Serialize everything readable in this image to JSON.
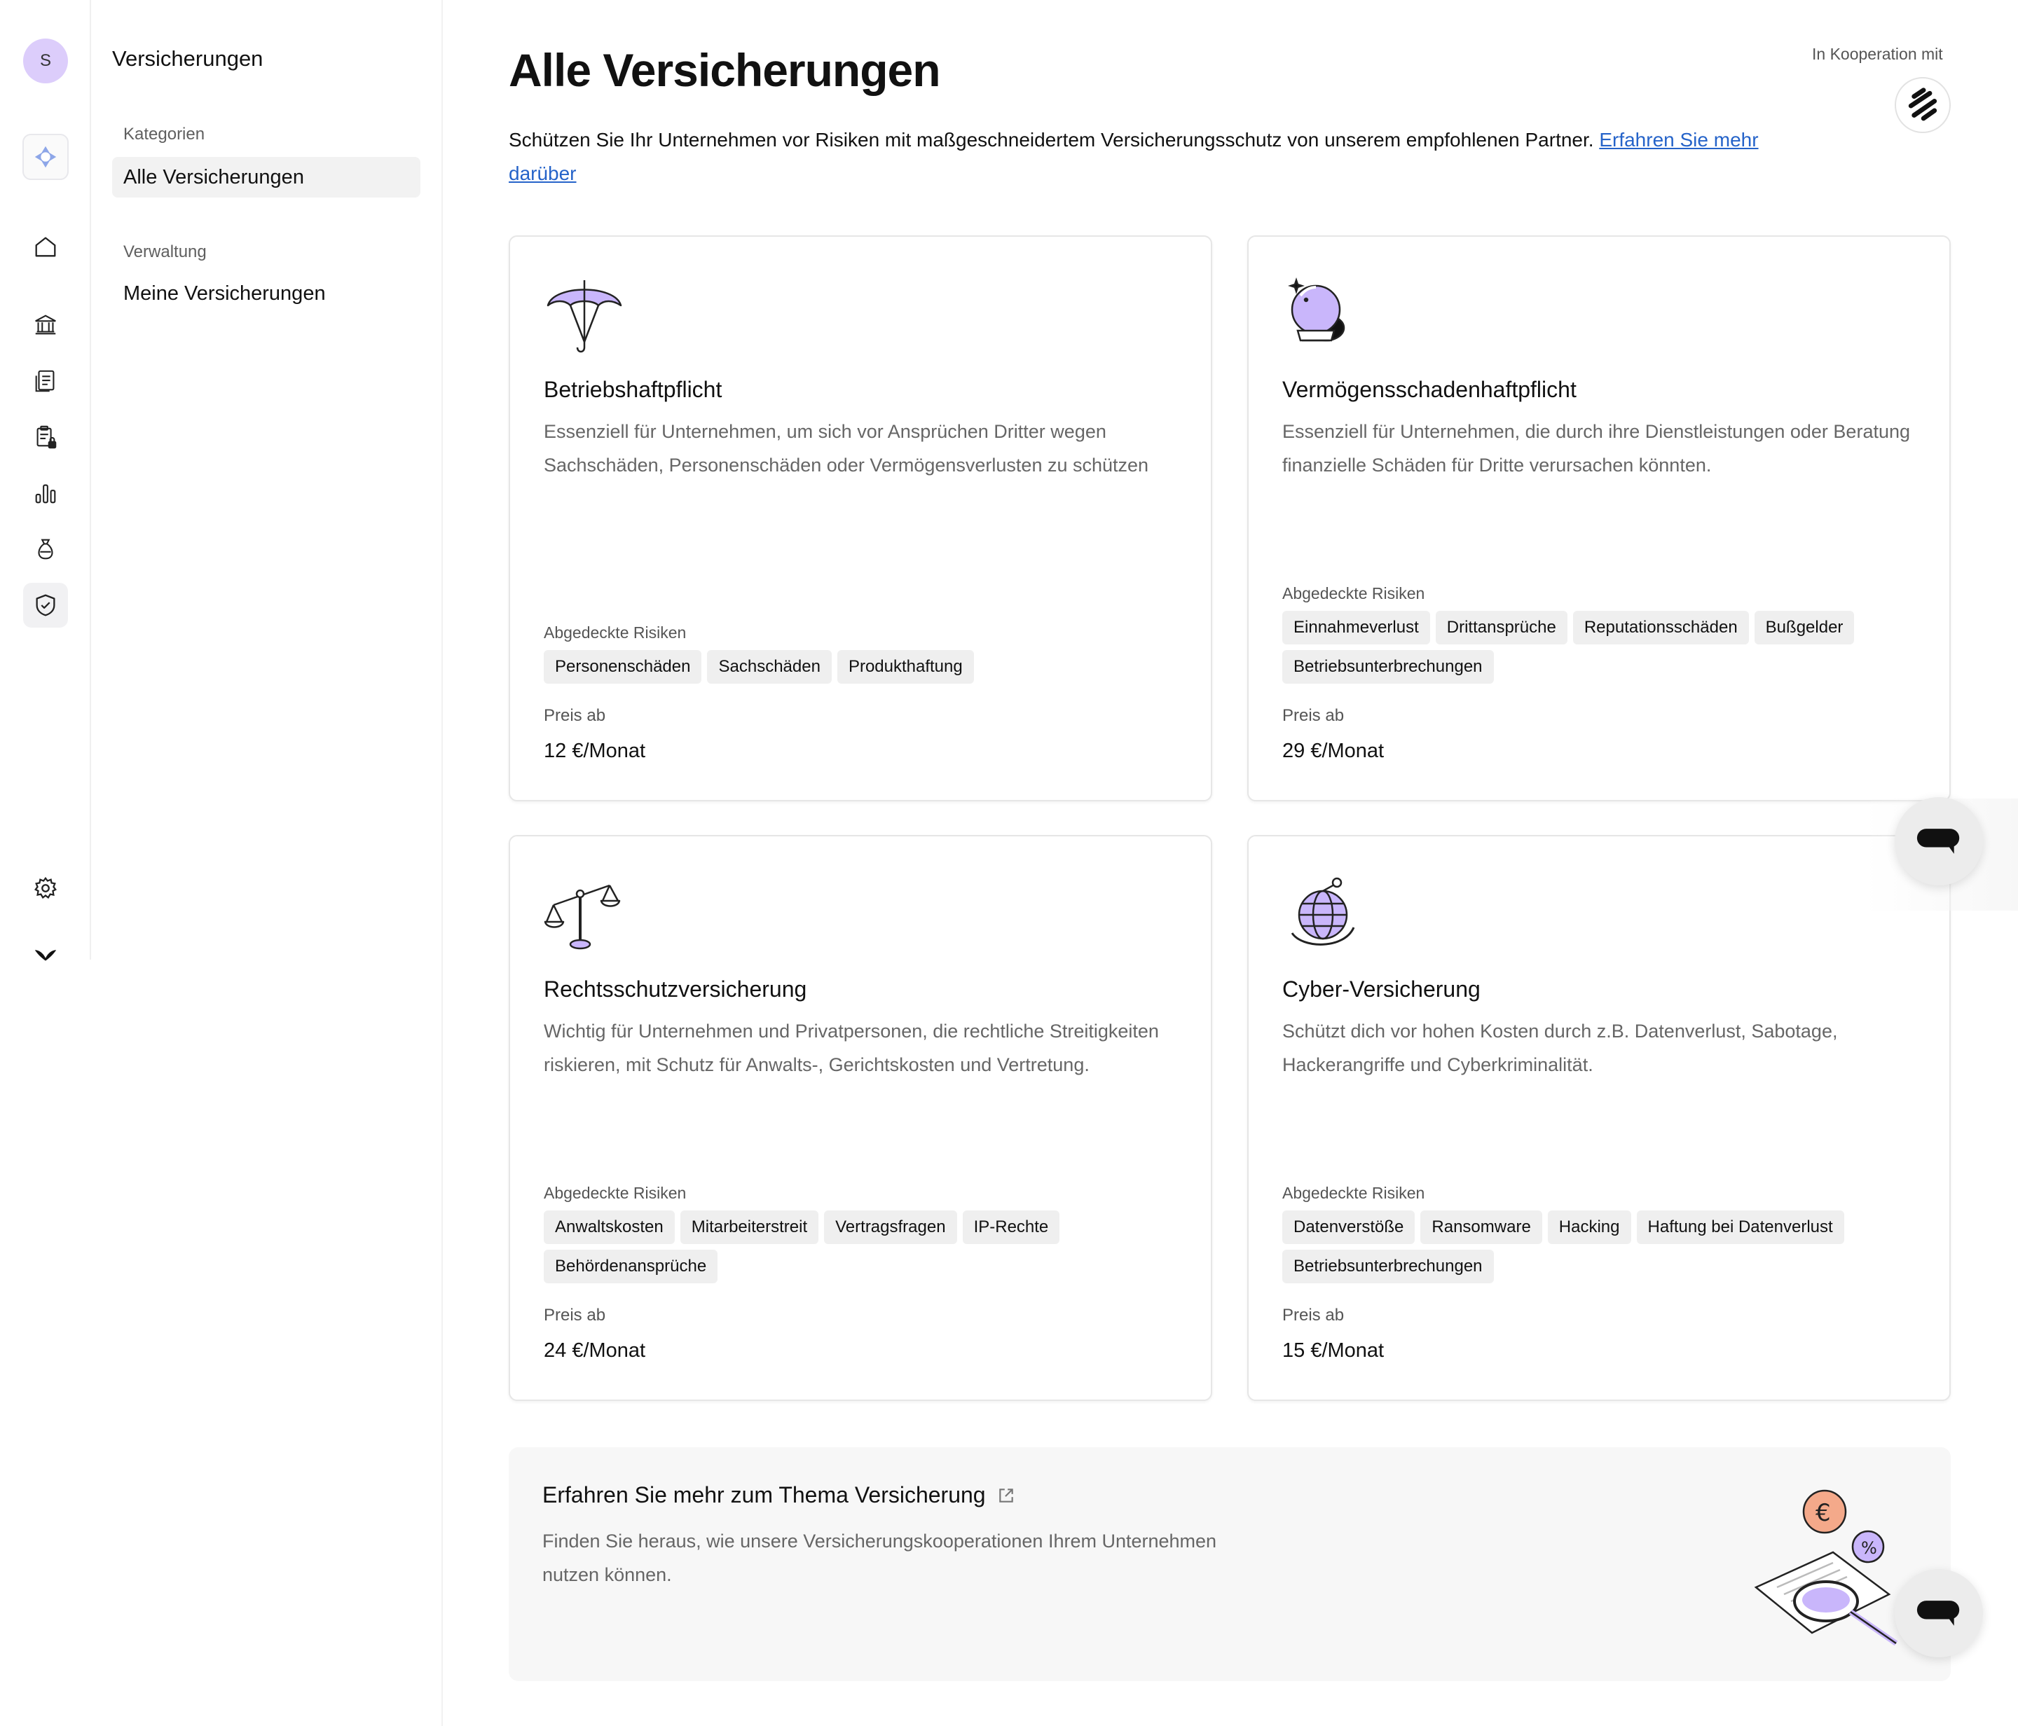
{
  "rail": {
    "avatar_initial": "S",
    "icons": [
      "app-logo-icon",
      "home-icon",
      "bank-icon",
      "document-list-icon",
      "clipboard-lock-icon",
      "bar-chart-icon",
      "money-bag-icon",
      "shield-check-icon",
      "gear-icon",
      "brand-bird-icon"
    ]
  },
  "subnav": {
    "title": "Versicherungen",
    "sections": [
      {
        "label": "Kategorien",
        "items": [
          {
            "label": "Alle Versicherungen",
            "active": true
          }
        ]
      },
      {
        "label": "Verwaltung",
        "items": [
          {
            "label": "Meine Versicherungen",
            "active": false
          }
        ]
      }
    ]
  },
  "header": {
    "title": "Alle Versicherungen",
    "coop_label": "In Kooperation mit",
    "intro_text": "Schützen Sie Ihr Unternehmen vor Risiken mit maßgeschneidertem Versicherungsschutz von unserem empfohlenen Partner. ",
    "intro_link": "Erfahren Sie mehr darüber"
  },
  "cards": [
    {
      "icon": "umbrella-icon",
      "title": "Betriebshaftpflicht",
      "description": "Essenziell für Unternehmen, um sich vor Ansprüchen Dritter wegen Sachschäden, Personenschäden oder Vermögensverlusten zu schützen",
      "risks_label": "Abgedeckte Risiken",
      "risks": [
        "Personenschäden",
        "Sachschäden",
        "Produkthaftung"
      ],
      "price_label": "Preis ab",
      "price": "12 €/Monat"
    },
    {
      "icon": "crystal-ball-icon",
      "title": "Vermögensschadenhaftpflicht",
      "description": "Essenziell für Unternehmen, die durch ihre Dienstleistungen oder Beratung finanzielle Schäden für Dritte verursachen könnten.",
      "risks_label": "Abgedeckte Risiken",
      "risks": [
        "Einnahmeverlust",
        "Drittansprüche",
        "Reputationsschäden",
        "Bußgelder",
        "Betriebsunterbrechungen"
      ],
      "price_label": "Preis ab",
      "price": "29 €/Monat"
    },
    {
      "icon": "scales-icon",
      "title": "Rechtsschutzversicherung",
      "description": "Wichtig für Unternehmen und Privatpersonen, die rechtliche Streitigkeiten riskieren, mit Schutz für Anwalts-, Gerichtskosten und Vertretung.",
      "risks_label": "Abgedeckte Risiken",
      "risks": [
        "Anwaltskosten",
        "Mitarbeiterstreit",
        "Vertragsfragen",
        "IP-Rechte",
        "Behördenansprüche"
      ],
      "price_label": "Preis ab",
      "price": "24 €/Monat"
    },
    {
      "icon": "globe-icon",
      "title": "Cyber-Versicherung",
      "description": "Schützt dich vor hohen Kosten durch z.B. Datenverlust, Sabotage, Hackerangriffe und Cyberkriminalität.",
      "risks_label": "Abgedeckte Risiken",
      "risks": [
        "Datenverstöße",
        "Ransomware",
        "Hacking",
        "Haftung bei Datenverlust",
        "Betriebsunterbrechungen"
      ],
      "price_label": "Preis ab",
      "price": "15 €/Monat"
    }
  ],
  "learn_more": {
    "title": "Erfahren Sie mehr zum Thema Versicherung",
    "description": "Finden Sie heraus, wie unsere Versicherungskooperationen Ihrem Unternehmen nutzen können.",
    "icon": "external-link-icon"
  },
  "colors": {
    "accent_purple": "#c9b6fb",
    "link_blue": "#2563c9",
    "chip_bg": "#efefef",
    "coin_orange": "#f4a98a"
  }
}
